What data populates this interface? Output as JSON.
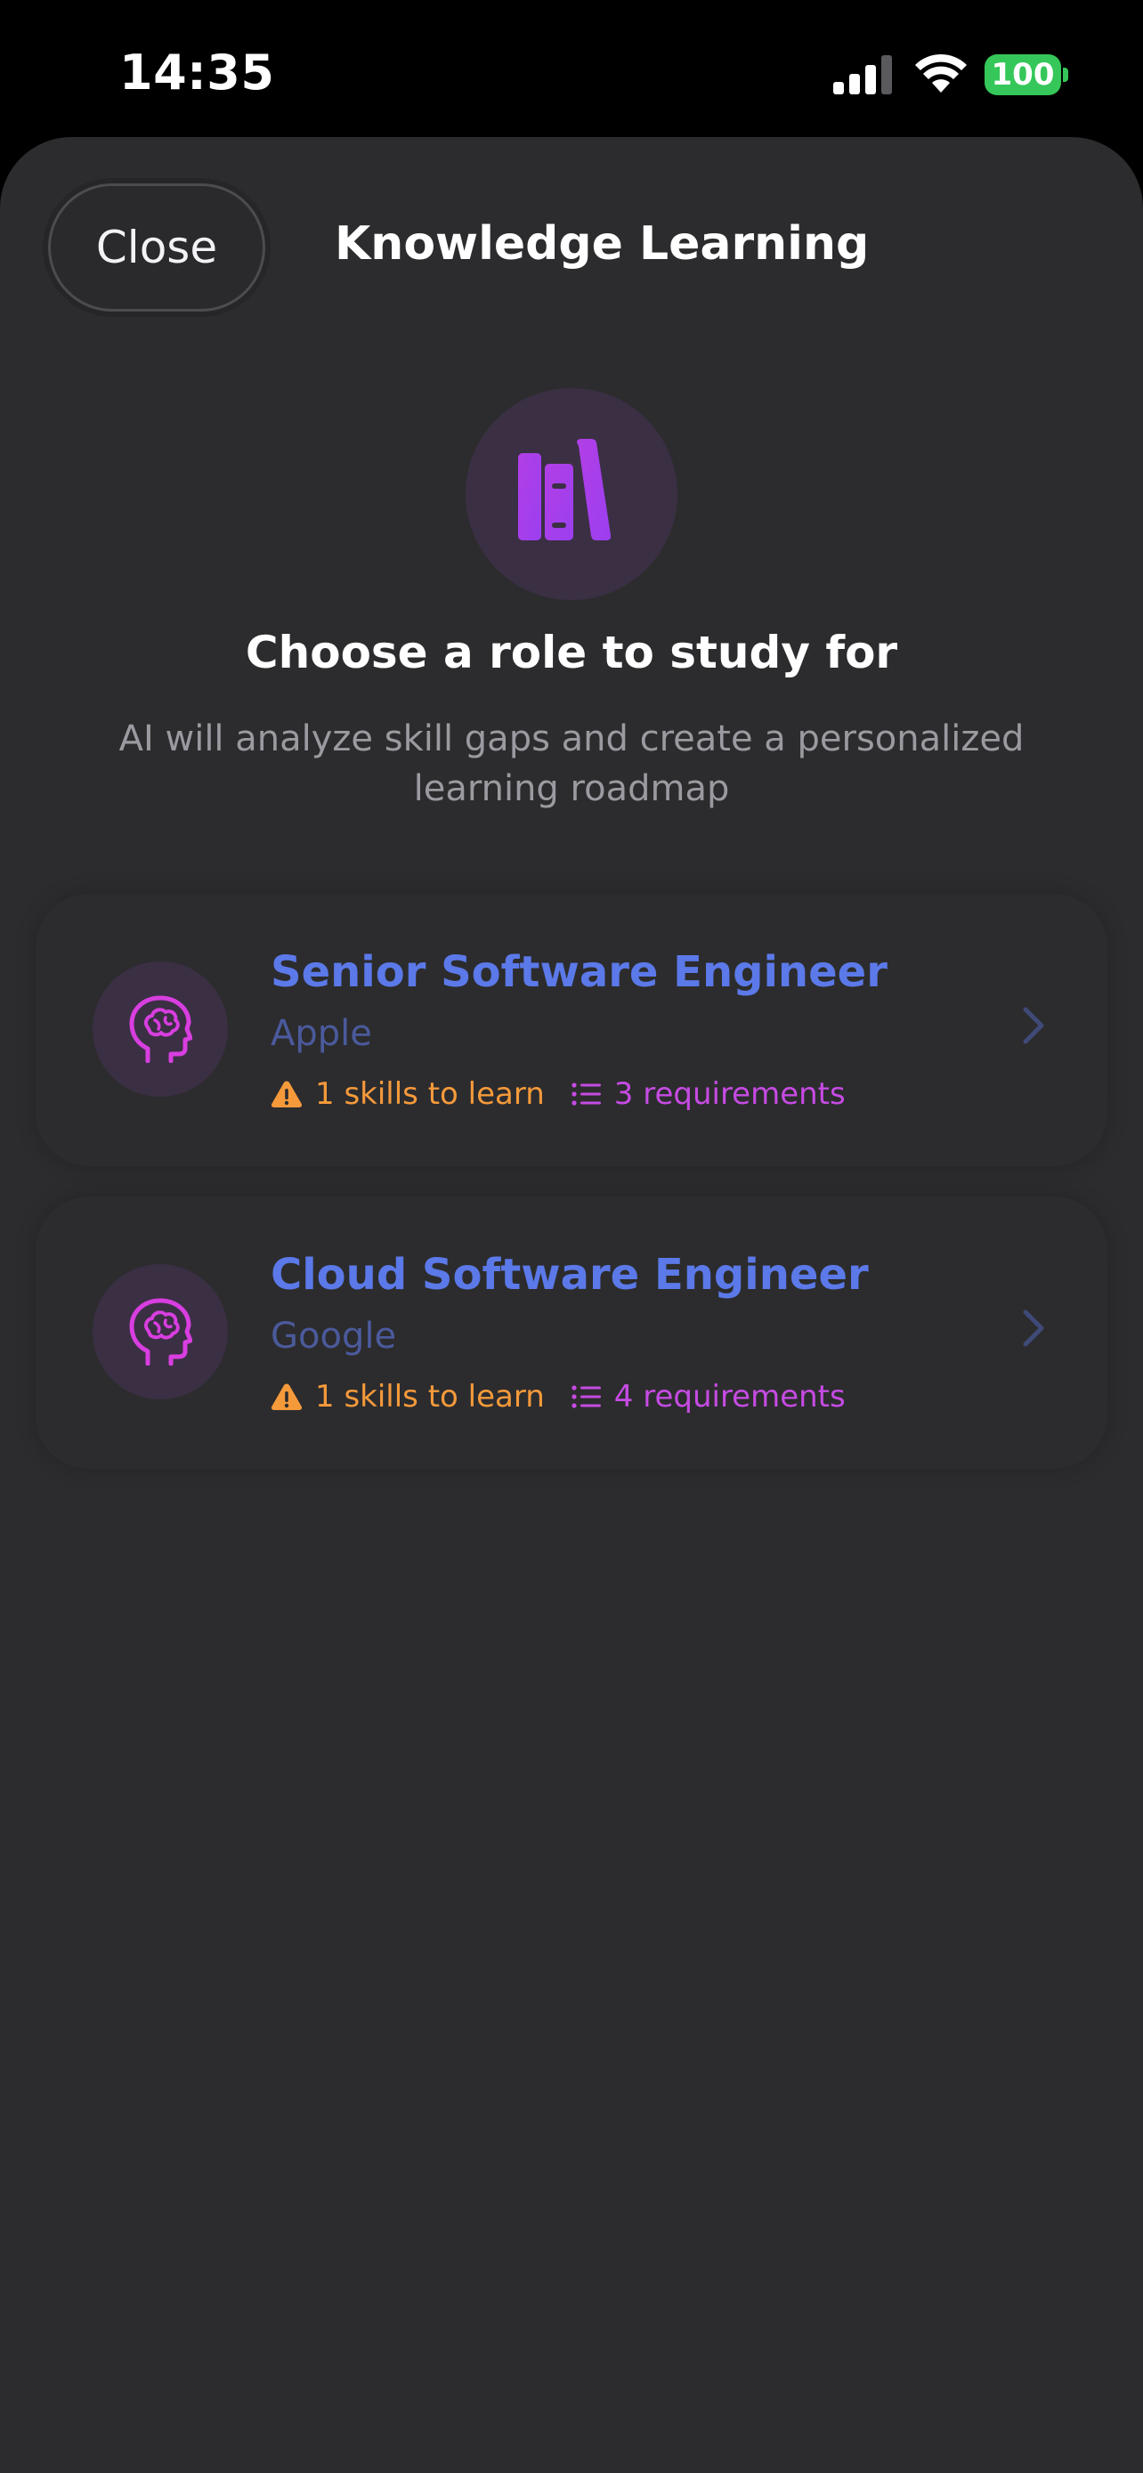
{
  "status_bar": {
    "time": "14:35",
    "battery": "100",
    "icons": [
      "signal-icon",
      "wifi-icon",
      "battery-icon"
    ]
  },
  "header": {
    "close_label": "Close",
    "title": "Knowledge Learning"
  },
  "hero": {
    "icon": "books-icon",
    "heading": "Choose a role to study for",
    "subheading": "AI will analyze skill gaps and create a personalized learning roadmap"
  },
  "roles": [
    {
      "icon": "brain-head-icon",
      "title": "Senior Software Engineer",
      "company": "Apple",
      "skills": "1 skills to learn",
      "requirements": "3 requirements"
    },
    {
      "icon": "brain-head-icon",
      "title": "Cloud Software Engineer",
      "company": "Google",
      "skills": "1 skills to learn",
      "requirements": "4 requirements"
    }
  ],
  "colors": {
    "accent_blue": "#5b79e8",
    "accent_purple": "#c64be3",
    "warning_orange": "#f59a3b",
    "battery_green": "#35c759",
    "sheet_bg": "#2c2c2e"
  }
}
